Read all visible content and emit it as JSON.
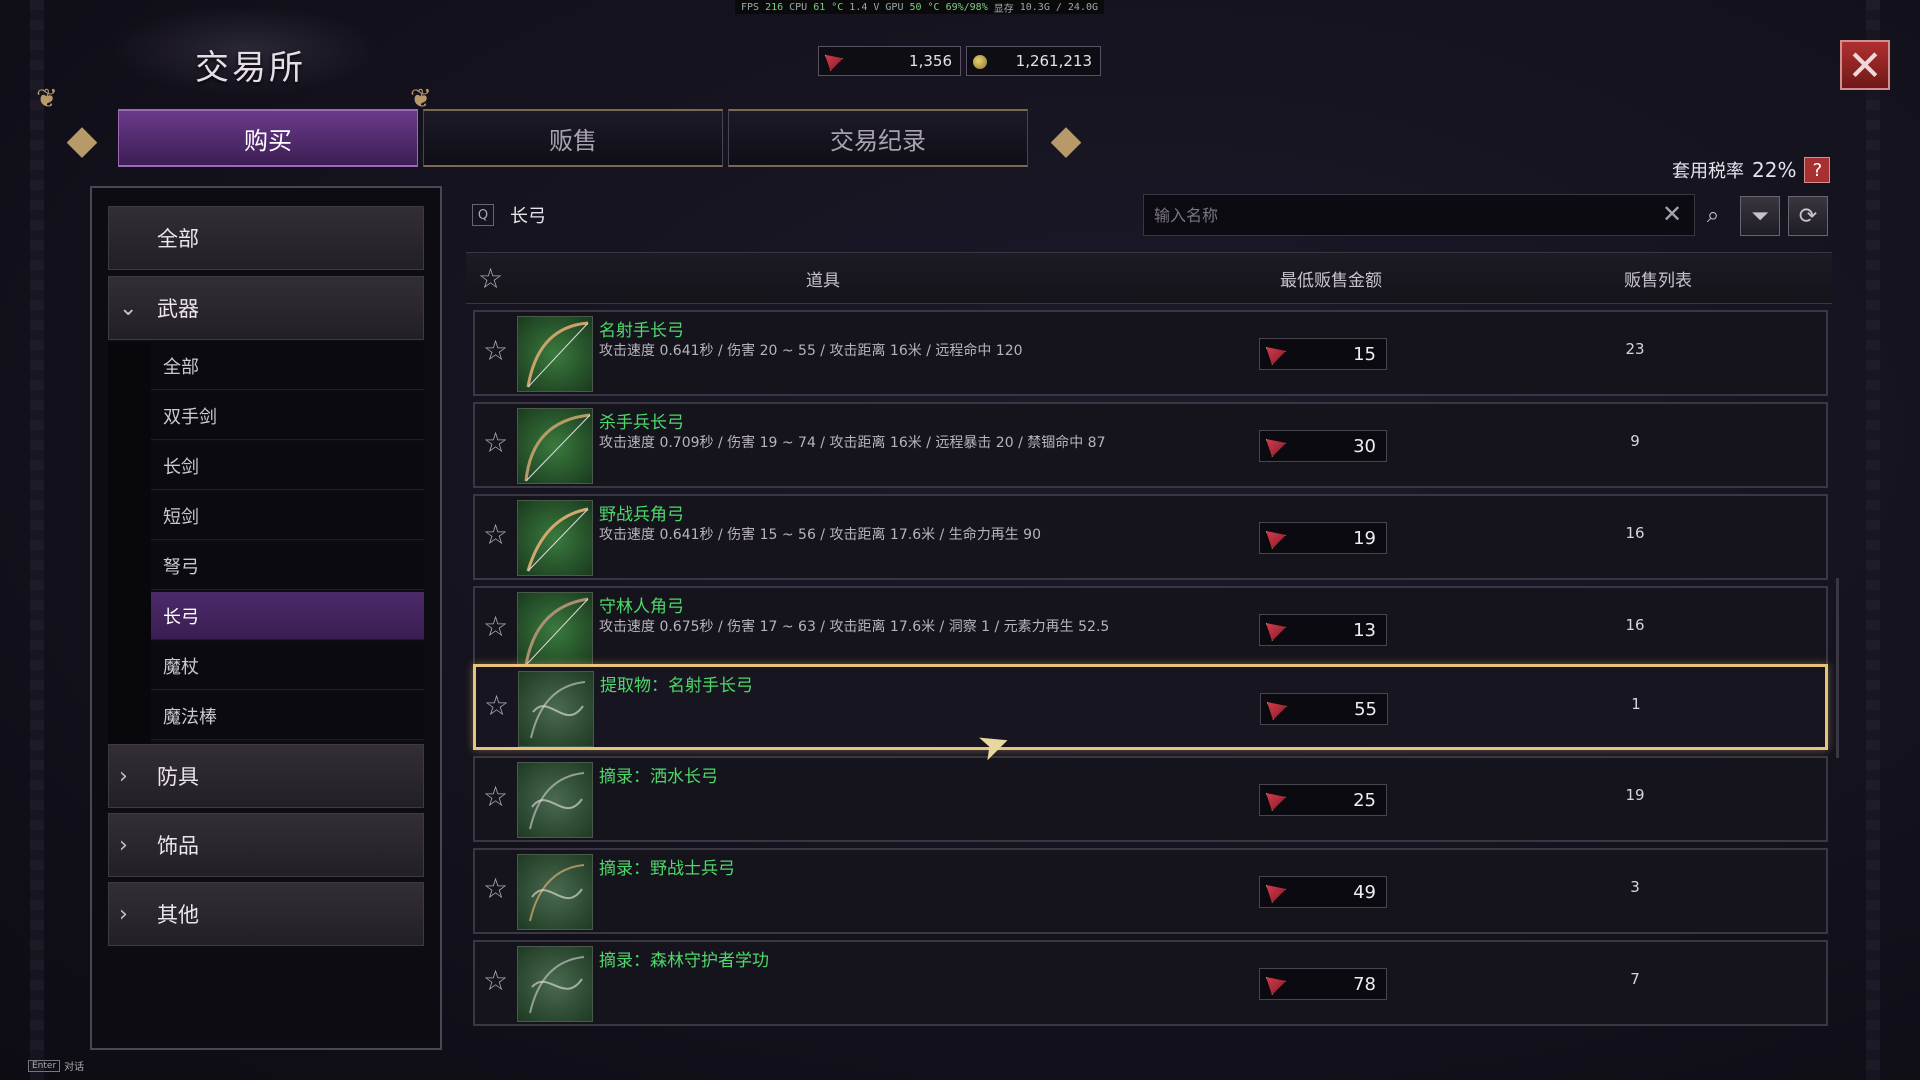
{
  "perf": {
    "fps_label": "FPS",
    "fps": "216",
    "cpu_label": "CPU",
    "cpu_temp": "61 °C",
    "cpu_v": "1.4 V",
    "gpu_label": "GPU",
    "gpu_temp": "50 °C",
    "gpu_load": "69%/98%",
    "mem_label": "显存",
    "mem": "10.3G / 24.0G"
  },
  "title": "交易所",
  "currency": {
    "tickets": "1,356",
    "gold": "1,261,213"
  },
  "tabs": [
    {
      "label": "购买",
      "active": true
    },
    {
      "label": "贩售",
      "active": false
    },
    {
      "label": "交易纪录",
      "active": false
    }
  ],
  "tax": {
    "label": "套用税率",
    "value": "22%",
    "help": "?"
  },
  "categories": {
    "all": "全部",
    "weapons": "武器",
    "weapon_subs": [
      "全部",
      "双手剑",
      "长剑",
      "短剑",
      "弩弓",
      "长弓",
      "魔杖",
      "魔法棒"
    ],
    "selected_sub": "长弓",
    "armor": "防具",
    "accessories": "饰品",
    "other": "其他"
  },
  "breadcrumb": {
    "icon": "Q",
    "text": "长弓"
  },
  "search": {
    "placeholder": "输入名称",
    "value": ""
  },
  "table": {
    "col_item": "道具",
    "col_price": "最低贩售金额",
    "col_listings": "贩售列表"
  },
  "rows": [
    {
      "name": "名射手长弓",
      "desc": "攻击速度 0.641秒 / 伤害 20 ~ 55 / 攻击距离 16米 / 远程命中 120",
      "price": "15",
      "listings": "23",
      "kind": "bow"
    },
    {
      "name": "杀手兵长弓",
      "desc": "攻击速度 0.709秒 / 伤害 19 ~ 74 / 攻击距离 16米 / 远程暴击 20 / 禁锢命中 87",
      "price": "30",
      "listings": "9",
      "kind": "bow"
    },
    {
      "name": "野战兵角弓",
      "desc": "攻击速度 0.641秒 / 伤害 15 ~ 56 / 攻击距离 17.6米 / 生命力再生 90",
      "price": "19",
      "listings": "16",
      "kind": "bow"
    },
    {
      "name": "守林人角弓",
      "desc": "攻击速度 0.675秒 / 伤害 17 ~ 63 / 攻击距离 17.6米 / 洞察 1 / 元素力再生 52.5",
      "price": "13",
      "listings": "16",
      "kind": "bow"
    },
    {
      "name": "提取物：名射手长弓",
      "desc": "",
      "price": "55",
      "listings": "1",
      "kind": "smoke",
      "highlighted": true
    },
    {
      "name": "摘录：洒水长弓",
      "desc": "",
      "price": "25",
      "listings": "19",
      "kind": "smoke"
    },
    {
      "name": "摘录：野战士兵弓",
      "desc": "",
      "price": "49",
      "listings": "3",
      "kind": "smoke"
    },
    {
      "name": "摘录：森林守护者学功",
      "desc": "",
      "price": "78",
      "listings": "7",
      "kind": "smoke"
    }
  ],
  "hint": {
    "key": "Enter",
    "label": "对话"
  }
}
